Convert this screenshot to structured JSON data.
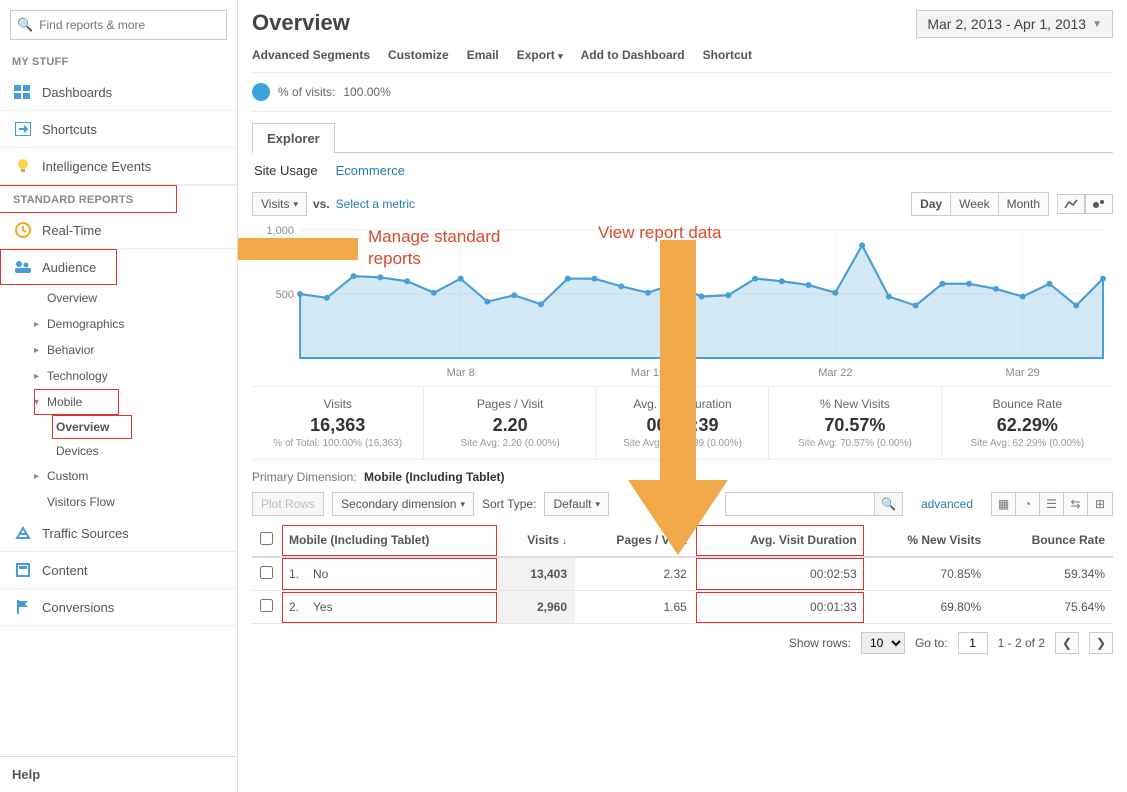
{
  "sidebar": {
    "search_placeholder": "Find reports & more",
    "my_stuff_title": "MY STUFF",
    "items_mystuff": [
      {
        "label": "Dashboards"
      },
      {
        "label": "Shortcuts"
      },
      {
        "label": "Intelligence Events"
      }
    ],
    "standard_title": "STANDARD REPORTS",
    "realtime": "Real-Time",
    "audience": {
      "label": "Audience",
      "children": [
        {
          "label": "Overview",
          "expandable": false
        },
        {
          "label": "Demographics",
          "expandable": true
        },
        {
          "label": "Behavior",
          "expandable": true
        },
        {
          "label": "Technology",
          "expandable": true
        },
        {
          "label": "Mobile",
          "expandable": true,
          "open": true,
          "children": [
            {
              "label": "Overview",
              "active": true
            },
            {
              "label": "Devices"
            }
          ]
        },
        {
          "label": "Custom",
          "expandable": true
        },
        {
          "label": "Visitors Flow",
          "expandable": false
        }
      ]
    },
    "other": [
      {
        "label": "Traffic Sources"
      },
      {
        "label": "Content"
      },
      {
        "label": "Conversions"
      }
    ],
    "help": "Help"
  },
  "header": {
    "title": "Overview",
    "date_range": "Mar 2, 2013 - Apr 1, 2013"
  },
  "toolbar": {
    "adv_segments": "Advanced Segments",
    "customize": "Customize",
    "email": "Email",
    "export": "Export",
    "add_dashboard": "Add to Dashboard",
    "shortcut": "Shortcut"
  },
  "pct_visits": {
    "label": "% of visits:",
    "value": "100.00%"
  },
  "tabs": {
    "explorer": "Explorer"
  },
  "subtabs": {
    "site_usage": "Site Usage",
    "ecommerce": "Ecommerce"
  },
  "chart_controls": {
    "visits_btn": "Visits",
    "vs": "vs.",
    "select_metric": "Select a metric",
    "day": "Day",
    "week": "Week",
    "month": "Month"
  },
  "chart_data": {
    "type": "line",
    "title": "",
    "xlabel": "",
    "ylabel": "",
    "ylim": [
      0,
      1000
    ],
    "y_ticks": [
      500,
      1000
    ],
    "categories_ticks": [
      "Mar 8",
      "Mar 15",
      "Mar 22",
      "Mar 29"
    ],
    "series": [
      {
        "name": "Visits",
        "values": [
          500,
          470,
          640,
          630,
          600,
          510,
          620,
          440,
          490,
          420,
          620,
          620,
          560,
          510,
          580,
          480,
          490,
          620,
          600,
          570,
          510,
          880,
          480,
          410,
          580,
          580,
          540,
          480,
          580,
          410,
          620
        ]
      }
    ]
  },
  "scorecards": [
    {
      "label": "Visits",
      "value": "16,363",
      "sub": "% of Total: 100.00% (16,363)"
    },
    {
      "label": "Pages / Visit",
      "value": "2.20",
      "sub": "Site Avg: 2.20 (0.00%)"
    },
    {
      "label": "Avg. Visit Duration",
      "value": "00:02:39",
      "sub": "Site Avg: 00:02:39 (0.00%)"
    },
    {
      "label": "% New Visits",
      "value": "70.57%",
      "sub": "Site Avg: 70.57% (0.00%)"
    },
    {
      "label": "Bounce Rate",
      "value": "62.29%",
      "sub": "Site Avg: 62.29% (0.00%)"
    }
  ],
  "dimension": {
    "label": "Primary Dimension:",
    "value": "Mobile (Including Tablet)"
  },
  "table_toolbar": {
    "plot_rows": "Plot Rows",
    "secondary_dim": "Secondary dimension",
    "sort_type": "Sort Type:",
    "sort_default": "Default",
    "advanced": "advanced"
  },
  "table": {
    "headers": [
      "",
      "Mobile (Including Tablet)",
      "Visits",
      "Pages / Visit",
      "Avg. Visit Duration",
      "% New Visits",
      "Bounce Rate"
    ],
    "rows": [
      {
        "idx": "1.",
        "dim": "No",
        "visits": "13,403",
        "ppv": "2.32",
        "avd": "00:02:53",
        "new": "70.85%",
        "bounce": "59.34%"
      },
      {
        "idx": "2.",
        "dim": "Yes",
        "visits": "2,960",
        "ppv": "1.65",
        "avd": "00:01:33",
        "new": "69.80%",
        "bounce": "75.64%"
      }
    ]
  },
  "pager": {
    "show_rows": "Show rows:",
    "rows_value": "10",
    "go_to": "Go to:",
    "goto_value": "1",
    "range": "1 - 2 of 2"
  },
  "callouts": {
    "left": "Manage standard\nreports",
    "right": "View report data"
  }
}
